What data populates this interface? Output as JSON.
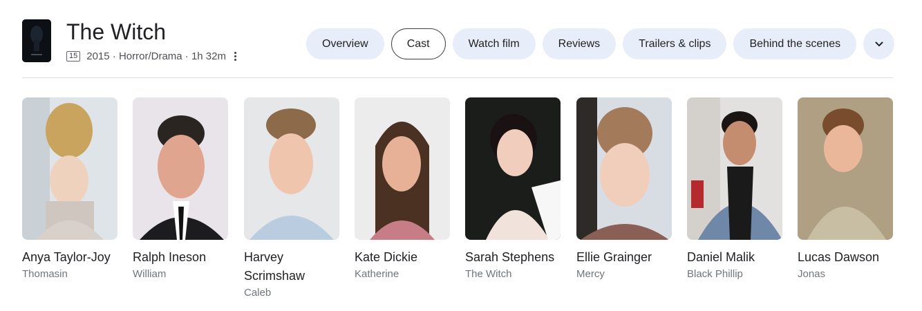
{
  "movie": {
    "title": "The Witch",
    "rating": "15",
    "meta": "2015 · Horror/Drama · 1h 32m",
    "more_icon": "more-vert-icon",
    "poster_icon": "poster-image"
  },
  "tabs": [
    {
      "label": "Overview"
    },
    {
      "label": "Cast",
      "active": true
    },
    {
      "label": "Watch film"
    },
    {
      "label": "Reviews"
    },
    {
      "label": "Trailers & clips"
    },
    {
      "label": "Behind the scenes"
    }
  ],
  "tabs_more_icon": "chevron-down-icon",
  "cast": [
    {
      "name": "Anya Taylor-Joy",
      "role": "Thomasin"
    },
    {
      "name": "Ralph Ineson",
      "role": "William"
    },
    {
      "name": "Harvey Scrimshaw",
      "role": "Caleb"
    },
    {
      "name": "Kate Dickie",
      "role": "Katherine"
    },
    {
      "name": "Sarah Stephens",
      "role": "The Witch"
    },
    {
      "name": "Ellie Grainger",
      "role": "Mercy"
    },
    {
      "name": "Daniel Malik",
      "role": "Black Phillip"
    },
    {
      "name": "Lucas Dawson",
      "role": "Jonas"
    }
  ],
  "colors": {
    "tab_bg": "#e8eef9",
    "active_tab_border": "#3c4043",
    "text_primary": "#202124",
    "text_secondary": "#70757a"
  }
}
